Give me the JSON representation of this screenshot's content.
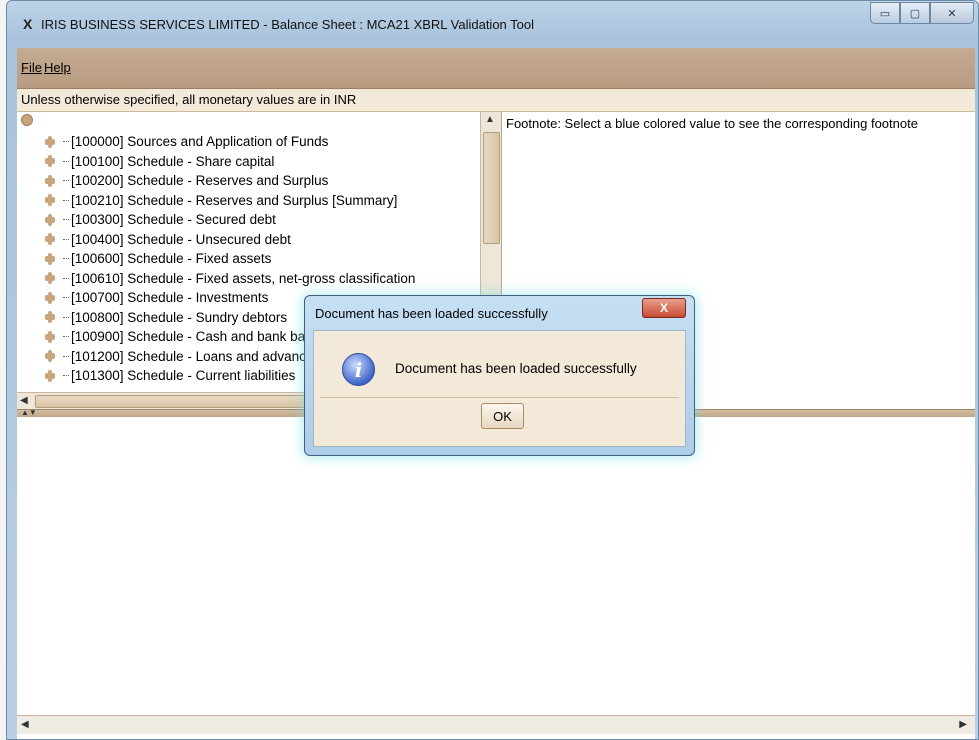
{
  "window": {
    "title_icon": "X",
    "title": "IRIS BUSINESS SERVICES LIMITED - Balance Sheet : MCA21 XBRL Validation Tool",
    "minimize_glyph": "▭",
    "maximize_glyph": "▢",
    "close_glyph": "✕"
  },
  "menu": {
    "file": "File",
    "help": "Help"
  },
  "info_text": "Unless otherwise specified, all monetary values are in INR",
  "tree": {
    "items": [
      "[100000] Sources and Application of Funds",
      "[100100] Schedule - Share capital",
      "[100200] Schedule - Reserves and Surplus",
      "[100210] Schedule - Reserves and Surplus [Summary]",
      "[100300] Schedule - Secured debt",
      "[100400] Schedule - Unsecured debt",
      "[100600] Schedule - Fixed assets",
      "[100610] Schedule - Fixed assets, net-gross classification",
      "[100700] Schedule - Investments",
      "[100800] Schedule - Sundry debtors",
      "[100900] Schedule - Cash and bank balances",
      "[101200] Schedule - Loans and advances",
      "[101300] Schedule - Current liabilities"
    ]
  },
  "footnote_text": "Footnote: Select a blue colored value to see the corresponding footnote",
  "dialog": {
    "title": "Document has been loaded successfully",
    "close_glyph": "X",
    "icon_glyph": "i",
    "message": "Document has been loaded successfully",
    "ok_label": "OK"
  },
  "scroll": {
    "up": "▲",
    "left": "◀",
    "right": "▶",
    "split": "▲▼"
  },
  "icons": [
    "app-x-icon",
    "minimize-icon",
    "maximize-icon",
    "close-icon",
    "tree-node-icon",
    "info-icon"
  ]
}
